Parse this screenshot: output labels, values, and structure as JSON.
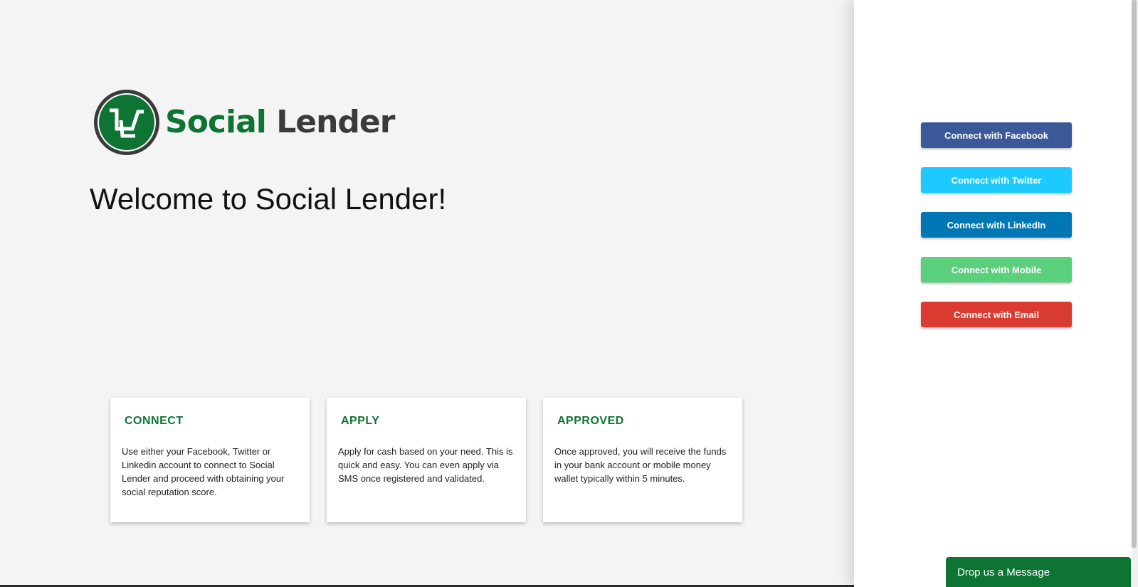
{
  "brand": {
    "name_part1": "Social",
    "name_part2": "Lender",
    "primary_color": "#0e7433",
    "dark_color": "#3b3b3b"
  },
  "main": {
    "welcome_title": "Welcome to Social Lender!",
    "cards": [
      {
        "title": "CONNECT",
        "text": "Use either your Facebook, Twitter or Linkedin account to connect to Social Lender and proceed with obtaining your social reputation score."
      },
      {
        "title": "APPLY",
        "text": "Apply for cash based on your need. This is quick and easy. You can even apply via SMS once registered and validated."
      },
      {
        "title": "APPROVED",
        "text": "Once approved, you will receive the funds in your bank account or mobile money wallet typically within 5 minutes."
      }
    ]
  },
  "login_panel": {
    "buttons": [
      {
        "label": "Connect with Facebook",
        "color": "#3b5998"
      },
      {
        "label": "Connect with Twitter",
        "color": "#1dcaff"
      },
      {
        "label": "Connect with LinkedIn",
        "color": "#0077b5"
      },
      {
        "label": "Connect with Mobile",
        "color": "#5acf7c"
      },
      {
        "label": "Connect with Email",
        "color": "#db3c32"
      }
    ]
  },
  "chat_widget": {
    "label": "Drop us a Message"
  }
}
